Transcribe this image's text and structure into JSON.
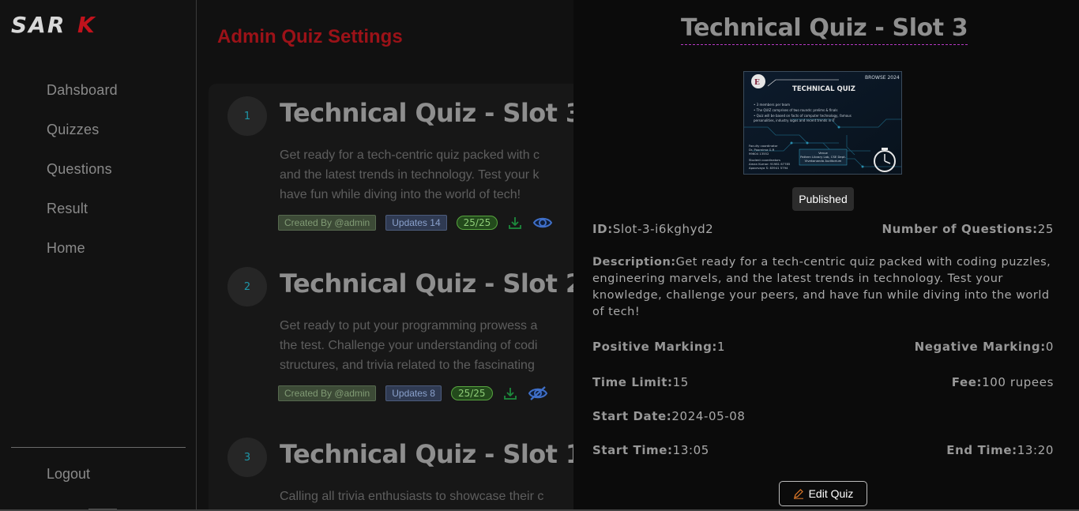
{
  "brand": {
    "logo_text": "SARK"
  },
  "sidebar": {
    "items": [
      {
        "label": "Dahsboard"
      },
      {
        "label": "Quizzes"
      },
      {
        "label": "Questions"
      },
      {
        "label": "Result"
      },
      {
        "label": "Home"
      }
    ],
    "logout_label": "Logout"
  },
  "page": {
    "title": "Admin Quiz Settings"
  },
  "quizzes": [
    {
      "num": "1",
      "title": "Technical Quiz - Slot 3",
      "desc": "Get ready for a tech-centric quiz packed with c\nand the latest trends in technology. Test your k\nhave fun while diving into the world of tech!",
      "created": "Created By @admin",
      "updates": "Updates 14",
      "score": "25/25",
      "visible": true
    },
    {
      "num": "2",
      "title": "Technical Quiz - Slot 2",
      "desc": "Get ready to put your programming prowess a\nthe test. Challenge your understanding of codi\nstructures, and trivia related to the fascinating",
      "created": "Created By @admin",
      "updates": "Updates 8",
      "score": "25/25",
      "visible": false
    },
    {
      "num": "3",
      "title": "Technical Quiz - Slot 1",
      "desc": "Calling all trivia enthusiasts to showcase their c"
    }
  ],
  "detail": {
    "title": "Technical Quiz - Slot 3",
    "poster": {
      "event": "BROWSE 2024",
      "heading": "TECHNICAL QUIZ",
      "bullets": [
        "• 3 members per team",
        "• The QUIZ comprises of two rounds: prelims & finals",
        "• Quiz will be based on facts of computer technology, famous",
        "  personalities, industry logos and recent trends in IT"
      ],
      "coordinator_label": "Faculty coordinator",
      "coordinator_name": "Dr. Poornima G.R",
      "coordinator_phone": "99604 13552",
      "students_label": "Student coordinators",
      "student1": "Aman Kumar: 91981 67785",
      "student2": "Apoorvaya S: 83941 5794",
      "venue_label": "Venue",
      "venue_line1": "Pattern Library Lab, CSE Dept.",
      "venue_line2": "Vivekananda Auditorium"
    },
    "status": "Published",
    "id_label": "ID:",
    "id_value": "Slot-3-i6kghyd2",
    "num_questions_label": "Number of Questions:",
    "num_questions_value": "25",
    "description_label": "Description:",
    "description_value": "Get ready for a tech-centric quiz packed with coding puzzles, engineering marvels, and the latest trends in technology. Test your knowledge, challenge your peers, and have fun while diving into the world of tech!",
    "positive_label": "Positive Marking:",
    "positive_value": "1",
    "negative_label": "Negative Marking:",
    "negative_value": "0",
    "time_limit_label": "Time Limit:",
    "time_limit_value": "15",
    "fee_label": "Fee:",
    "fee_value": "100 rupees",
    "start_date_label": "Start Date:",
    "start_date_value": "2024-05-08",
    "start_time_label": "Start Time:",
    "start_time_value": "13:05",
    "end_time_label": "End Time:",
    "end_time_value": "13:20",
    "edit_label": "Edit Quiz"
  },
  "colors": {
    "accent_red": "#9c1218",
    "number_teal": "#1e96a8",
    "download_green": "#1d8a3c",
    "eye_blue": "#3f6fc8"
  },
  "icons": [
    "download-icon",
    "eye-icon",
    "eye-off-icon",
    "pencil-icon"
  ]
}
